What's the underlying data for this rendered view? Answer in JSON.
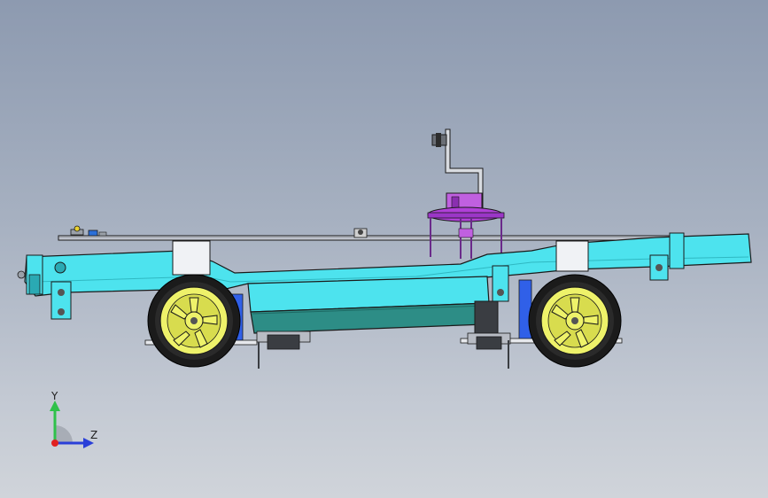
{
  "viewport": {
    "background_top": "#8d9ab0",
    "background_bottom": "#d0d4da"
  },
  "model": {
    "description_icon": "rc-car-chassis-side-view",
    "colors": {
      "frame": "#4de3ee",
      "frame_dark": "#2a8f96",
      "battery_dark": "#2d8d86",
      "wheel_rim": "#eef26a",
      "tire": "#1b1b1b",
      "shock": "#3060e8",
      "servo": "#b040d8",
      "outline": "#1a1a1a"
    }
  },
  "triad": {
    "y_label": "Y",
    "z_label": "Z",
    "y_color": "#2fc14a",
    "z_color": "#2a3fd8",
    "x_color": "#e02020"
  }
}
